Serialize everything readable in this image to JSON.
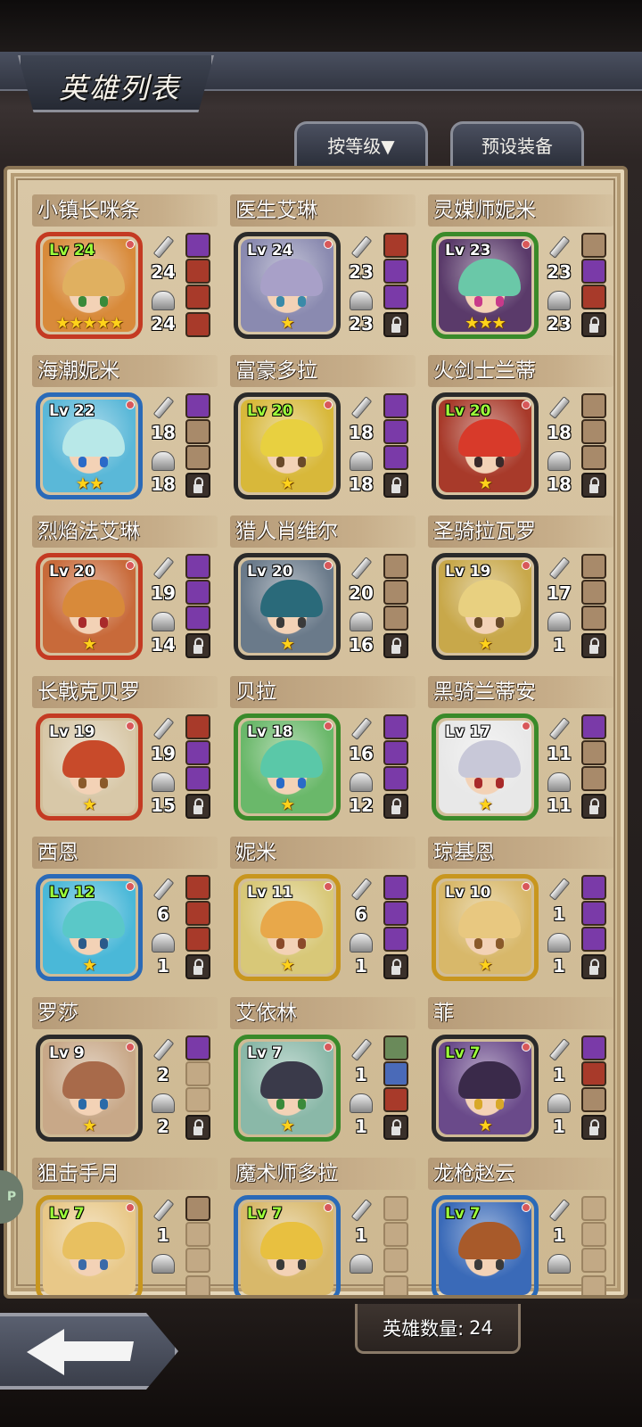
{
  "header": {
    "title": "英雄列表",
    "sort_button": "按等级▼",
    "preset_button": "预设装备"
  },
  "footer": {
    "hero_count_label": "英雄数量:",
    "hero_count_value": "24"
  },
  "side_tab": {
    "label": "P"
  },
  "heroes": [
    {
      "name": "小镇长咪条",
      "level": "Lv 24",
      "level_color": "green",
      "stars": "★★★★★",
      "attack": "24",
      "defense": "24",
      "frame": "#c43a22",
      "bg": "#d88a3a",
      "hair": "#e0b060",
      "eye": "#3a8a3a",
      "slots": [
        "item",
        "item",
        "item",
        "item"
      ],
      "slot_colors": [
        "#7a3aa8",
        "#a83a2a",
        "#a83a2a",
        "#a83a2a"
      ]
    },
    {
      "name": "医生艾琳",
      "level": "Lv 24",
      "level_color": "white",
      "stars": "★",
      "attack": "23",
      "defense": "23",
      "frame": "#2a2a2a",
      "bg": "#8a8ab0",
      "hair": "#a8a0c8",
      "eye": "#3a8aa8",
      "slots": [
        "item",
        "item",
        "item",
        "locked"
      ],
      "slot_colors": [
        "#a83a2a",
        "#7a3aa8",
        "#7a3aa8",
        ""
      ]
    },
    {
      "name": "灵媒师妮米",
      "level": "Lv 23",
      "level_color": "white",
      "stars": "★★★",
      "attack": "23",
      "defense": "23",
      "frame": "#3a8a2a",
      "bg": "#5a3a6a",
      "hair": "#6ac8a8",
      "eye": "#c83a8a",
      "slots": [
        "item",
        "item",
        "item",
        "locked"
      ],
      "slot_colors": [
        "#a88a6a",
        "#7a3aa8",
        "#a83a2a",
        ""
      ]
    },
    {
      "name": "海潮妮米",
      "level": "Lv 22",
      "level_color": "white",
      "stars": "★★",
      "attack": "18",
      "defense": "18",
      "frame": "#2a6ab8",
      "bg": "#5ab8d8",
      "hair": "#b8e8e8",
      "eye": "#2a6ac8",
      "slots": [
        "item",
        "item",
        "item",
        "locked"
      ],
      "slot_colors": [
        "#7a3aa8",
        "#a88a6a",
        "#a88a6a",
        ""
      ]
    },
    {
      "name": "富豪多拉",
      "level": "Lv 20",
      "level_color": "green",
      "stars": "★",
      "attack": "18",
      "defense": "18",
      "frame": "#2a2a2a",
      "bg": "#d8b83a",
      "hair": "#e8d040",
      "eye": "#6a4a2a",
      "slots": [
        "item",
        "item",
        "item",
        "locked"
      ],
      "slot_colors": [
        "#7a3aa8",
        "#7a3aa8",
        "#7a3aa8",
        ""
      ]
    },
    {
      "name": "火剑士兰蒂",
      "level": "Lv 20",
      "level_color": "green",
      "stars": "★",
      "attack": "18",
      "defense": "18",
      "frame": "#2a2a2a",
      "bg": "#a83a2a",
      "hair": "#d83a2a",
      "eye": "#3a2a2a",
      "slots": [
        "item",
        "item",
        "item",
        "locked"
      ],
      "slot_colors": [
        "#a88a6a",
        "#a88a6a",
        "#a88a6a",
        ""
      ]
    },
    {
      "name": "烈焰法艾琳",
      "level": "Lv 20",
      "level_color": "white",
      "stars": "★",
      "attack": "19",
      "defense": "14",
      "frame": "#c43a22",
      "bg": "#c86a3a",
      "hair": "#d88a3a",
      "eye": "#a82a2a",
      "slots": [
        "item",
        "item",
        "item",
        "locked"
      ],
      "slot_colors": [
        "#7a3aa8",
        "#7a3aa8",
        "#7a3aa8",
        ""
      ]
    },
    {
      "name": "猎人肖维尔",
      "level": "Lv 20",
      "level_color": "white",
      "stars": "★",
      "attack": "20",
      "defense": "16",
      "frame": "#2a2a2a",
      "bg": "#6a7a8a",
      "hair": "#2a6a7a",
      "eye": "#3a3a3a",
      "slots": [
        "item",
        "item",
        "item",
        "locked"
      ],
      "slot_colors": [
        "#a88a6a",
        "#a88a6a",
        "#a88a6a",
        ""
      ]
    },
    {
      "name": "圣骑拉瓦罗",
      "level": "Lv 19",
      "level_color": "white",
      "stars": "★",
      "attack": "17",
      "defense": "1",
      "frame": "#2a2a2a",
      "bg": "#c8a84a",
      "hair": "#e8d080",
      "eye": "#6a4a2a",
      "slots": [
        "item",
        "item",
        "item",
        "locked"
      ],
      "slot_colors": [
        "#a88a6a",
        "#a88a6a",
        "#a88a6a",
        ""
      ]
    },
    {
      "name": "长戟克贝罗",
      "level": "Lv 19",
      "level_color": "white",
      "stars": "★",
      "attack": "19",
      "defense": "15",
      "frame": "#c43a22",
      "bg": "#d8c8a8",
      "hair": "#c84a2a",
      "eye": "#8a5a2a",
      "slots": [
        "item",
        "item",
        "item",
        "locked"
      ],
      "slot_colors": [
        "#a83a2a",
        "#7a3aa8",
        "#7a3aa8",
        ""
      ]
    },
    {
      "name": "贝拉",
      "level": "Lv 18",
      "level_color": "white",
      "stars": "★",
      "attack": "16",
      "defense": "12",
      "frame": "#3a8a2a",
      "bg": "#6ab86a",
      "hair": "#5ac8a8",
      "eye": "#2a6ac8",
      "slots": [
        "item",
        "item",
        "item",
        "locked"
      ],
      "slot_colors": [
        "#7a3aa8",
        "#7a3aa8",
        "#7a3aa8",
        ""
      ]
    },
    {
      "name": "黑骑兰蒂安",
      "level": "Lv 17",
      "level_color": "white",
      "stars": "★",
      "attack": "11",
      "defense": "11",
      "frame": "#3a8a2a",
      "bg": "#e8e8e8",
      "hair": "#c8c8d8",
      "eye": "#a82a2a",
      "slots": [
        "item",
        "item",
        "item",
        "locked"
      ],
      "slot_colors": [
        "#7a3aa8",
        "#a88a6a",
        "#a88a6a",
        ""
      ]
    },
    {
      "name": "西恩",
      "level": "Lv 12",
      "level_color": "green",
      "stars": "★",
      "attack": "6",
      "defense": "1",
      "frame": "#2a6ab8",
      "bg": "#4ab8d8",
      "hair": "#5ac8c8",
      "eye": "#2a5a8a",
      "slots": [
        "item",
        "item",
        "item",
        "locked"
      ],
      "slot_colors": [
        "#a83a2a",
        "#a83a2a",
        "#a83a2a",
        ""
      ]
    },
    {
      "name": "妮米",
      "level": "Lv 11",
      "level_color": "white",
      "stars": "★",
      "attack": "6",
      "defense": "1",
      "frame": "#c8961e",
      "bg": "#d8c878",
      "hair": "#e8a84a",
      "eye": "#8a4a2a",
      "slots": [
        "item",
        "item",
        "item",
        "locked"
      ],
      "slot_colors": [
        "#7a3aa8",
        "#7a3aa8",
        "#7a3aa8",
        ""
      ]
    },
    {
      "name": "琼基恩",
      "level": "Lv 10",
      "level_color": "white",
      "stars": "★",
      "attack": "1",
      "defense": "1",
      "frame": "#c8961e",
      "bg": "#d8b86a",
      "hair": "#e8c880",
      "eye": "#8a5a2a",
      "slots": [
        "item",
        "item",
        "item",
        "locked"
      ],
      "slot_colors": [
        "#7a3aa8",
        "#7a3aa8",
        "#7a3aa8",
        ""
      ]
    },
    {
      "name": "罗莎",
      "level": "Lv 9",
      "level_color": "white",
      "stars": "★",
      "attack": "2",
      "defense": "2",
      "frame": "#2a2a2a",
      "bg": "#c8a888",
      "hair": "#a86a4a",
      "eye": "#2a6aa8",
      "slots": [
        "item",
        "empty",
        "empty",
        "locked"
      ],
      "slot_colors": [
        "#7a3aa8",
        "",
        "",
        ""
      ]
    },
    {
      "name": "艾依林",
      "level": "Lv 7",
      "level_color": "white",
      "stars": "★",
      "attack": "1",
      "defense": "1",
      "frame": "#3a8a2a",
      "bg": "#8ab8a8",
      "hair": "#3a3a4a",
      "eye": "#3a8a3a",
      "slots": [
        "item",
        "item",
        "item",
        "locked"
      ],
      "slot_colors": [
        "#6a8a5a",
        "#4a6ab8",
        "#a83a2a",
        ""
      ]
    },
    {
      "name": "菲",
      "level": "Lv 7",
      "level_color": "green",
      "stars": "★",
      "attack": "1",
      "defense": "1",
      "frame": "#2a2a2a",
      "bg": "#6a4a8a",
      "hair": "#3a2a4a",
      "eye": "#d8a82a",
      "slots": [
        "item",
        "item",
        "item",
        "locked"
      ],
      "slot_colors": [
        "#7a3aa8",
        "#a83a2a",
        "#a88a6a",
        ""
      ]
    },
    {
      "name": "狙击手月",
      "level": "Lv 7",
      "level_color": "green",
      "stars": "",
      "attack": "1",
      "defense": "",
      "frame": "#c8961e",
      "bg": "#e8c888",
      "hair": "#e8c060",
      "eye": "#3a6aa8",
      "slots": [
        "item",
        "empty",
        "empty",
        "empty"
      ],
      "slot_colors": [
        "#a88a6a",
        "",
        "",
        ""
      ]
    },
    {
      "name": "魔术师多拉",
      "level": "Lv 7",
      "level_color": "green",
      "stars": "",
      "attack": "1",
      "defense": "",
      "frame": "#2a6ab8",
      "bg": "#d8b86a",
      "hair": "#e8c040",
      "eye": "#3a3a3a",
      "slots": [
        "empty",
        "empty",
        "empty",
        "empty"
      ],
      "slot_colors": [
        "",
        "",
        "",
        ""
      ]
    },
    {
      "name": "龙枪赵云",
      "level": "Lv 7",
      "level_color": "green",
      "stars": "",
      "attack": "1",
      "defense": "",
      "frame": "#2a6ab8",
      "bg": "#3a6ab8",
      "hair": "#a85a2a",
      "eye": "#3a3a3a",
      "slots": [
        "empty",
        "empty",
        "empty",
        "empty"
      ],
      "slot_colors": [
        "",
        "",
        "",
        ""
      ]
    }
  ]
}
